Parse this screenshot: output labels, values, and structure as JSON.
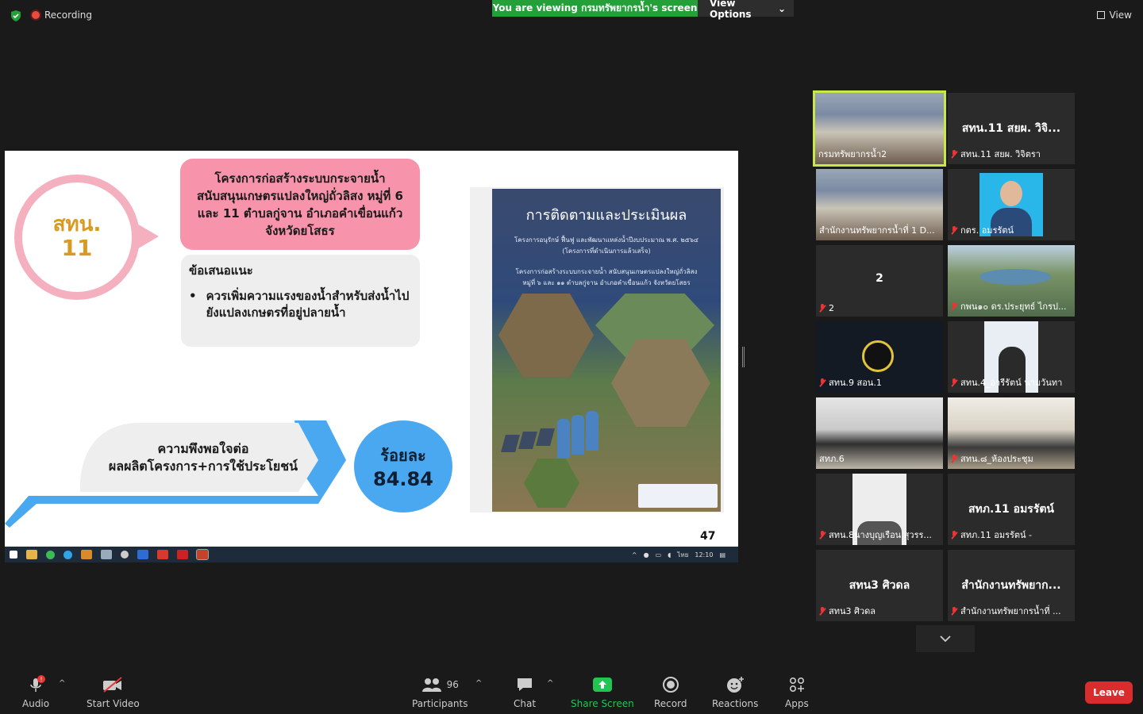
{
  "topbar": {
    "recording_label": "Recording",
    "viewing_banner": "You are viewing กรมทรัพยากรน้ำ's screen",
    "view_options_label": "View Options",
    "view_label": "View"
  },
  "slide": {
    "circle_line1": "สทน.",
    "circle_line2": "11",
    "project_title": "โครงการก่อสร้างระบบกระจายน้ำ สนับสนุนเกษตรแปลงใหญ่ถั่วลิสง หมู่ที่ 6 และ 11 ตำบลกู่จาน อำเภอคำเขื่อนแก้ว จังหวัดยโสธร",
    "recommendation_title": "ข้อเสนอแนะ",
    "recommendation_item": "ควรเพิ่มความแรงของน้ำสำหรับส่งน้ำไปยังแปลงเกษตรที่อยู่ปลายน้ำ",
    "satisfaction_line1": "ความพึงพอใจต่อ",
    "satisfaction_line2": "ผลผลิตโครงการ+การใช้ประโยชน์",
    "percent_label": "ร้อยละ",
    "percent_value": "84.84",
    "page_number": "47",
    "cover_title": "การติดตามและประเมินผล",
    "cover_sub1_a": "โครงการอนุรักษ์ ฟื้นฟู และพัฒนาแหล่งน้ำปีงบประมาณ พ.ศ. ๒๕๖๔",
    "cover_sub1_b": "(โครงการที่ดำเนินการแล้วเสร็จ)",
    "cover_sub2_a": "โครงการก่อสร้างระบบกระจายน้ำ สนับสนุนเกษตรแปลงใหญ่ถั่วลิสง",
    "cover_sub2_b": "หมู่ที่ ๖ และ ๑๑ ตำบลกู่จาน อำเภอคำเขื่อนแก้ว จังหวัดยโสธร"
  },
  "taskbar": {
    "lang": "ไทย",
    "time": "12:10"
  },
  "gallery": [
    {
      "name": "กรมทรัพยากรน้ำ2",
      "big": ""
    },
    {
      "name": "สทน.11 สยผ. วิจิตรา",
      "big": "สทน.11 สยผ. วิจิ..."
    },
    {
      "name": "สำนักงานทรัพยากรน้ำที่ 1 D...",
      "big": ""
    },
    {
      "name": "กตร. อมรรัตน์",
      "big": ""
    },
    {
      "name": "2",
      "big": "2"
    },
    {
      "name": "กพน๑๐ ดร.ประยุทธ์  ไกรป...",
      "big": ""
    },
    {
      "name": "สทน.9 สอน.1",
      "big": ""
    },
    {
      "name": "สทน.4_อารีรัตน์  นามวันทา",
      "big": ""
    },
    {
      "name": "สทภ.6",
      "big": ""
    },
    {
      "name": "สทน.๘_ห้องประชุม",
      "big": ""
    },
    {
      "name": "สทน.8นางบุญเรือน สุวรร...",
      "big": ""
    },
    {
      "name": "สทภ.11 อมรรัตน์ -",
      "big": "สทภ.11 อมรรัตน์"
    },
    {
      "name": "สทน3 ศิวดล",
      "big": "สทน3 ศิวดล"
    },
    {
      "name": "สำนักงานทรัพยากรน้ำที่ ...",
      "big": "สำนักงานทรัพยาก..."
    }
  ],
  "toolbar": {
    "audio": "Audio",
    "start_video": "Start Video",
    "participants_count": "96",
    "participants": "Participants",
    "chat": "Chat",
    "share_screen": "Share Screen",
    "record": "Record",
    "reactions": "Reactions",
    "apps": "Apps",
    "leave": "Leave"
  },
  "colors": {
    "banner_green": "#23a037",
    "slide_pink": "#f794ab",
    "slide_blue": "#4aa8f0",
    "active_speaker": "#c8e84a",
    "leave_red": "#d92c2c"
  }
}
